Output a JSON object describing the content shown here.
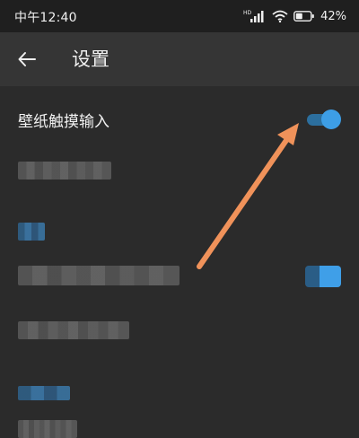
{
  "status_bar": {
    "time": "中午12:40",
    "network_label": "HD",
    "battery_text": "42%",
    "icons": [
      "hd-signal-icon",
      "wifi-icon",
      "battery-icon"
    ]
  },
  "app_bar": {
    "back_icon": "back-arrow-icon",
    "title": "设置"
  },
  "settings": {
    "wallpaper_touch": {
      "label": "壁纸触摸输入",
      "enabled": true
    }
  },
  "annotation": {
    "arrow_color": "#f0925a"
  },
  "colors": {
    "background": "#2b2b2b",
    "app_bar": "#353535",
    "status_bar": "#1f1f1f",
    "accent": "#3d9ee6"
  }
}
